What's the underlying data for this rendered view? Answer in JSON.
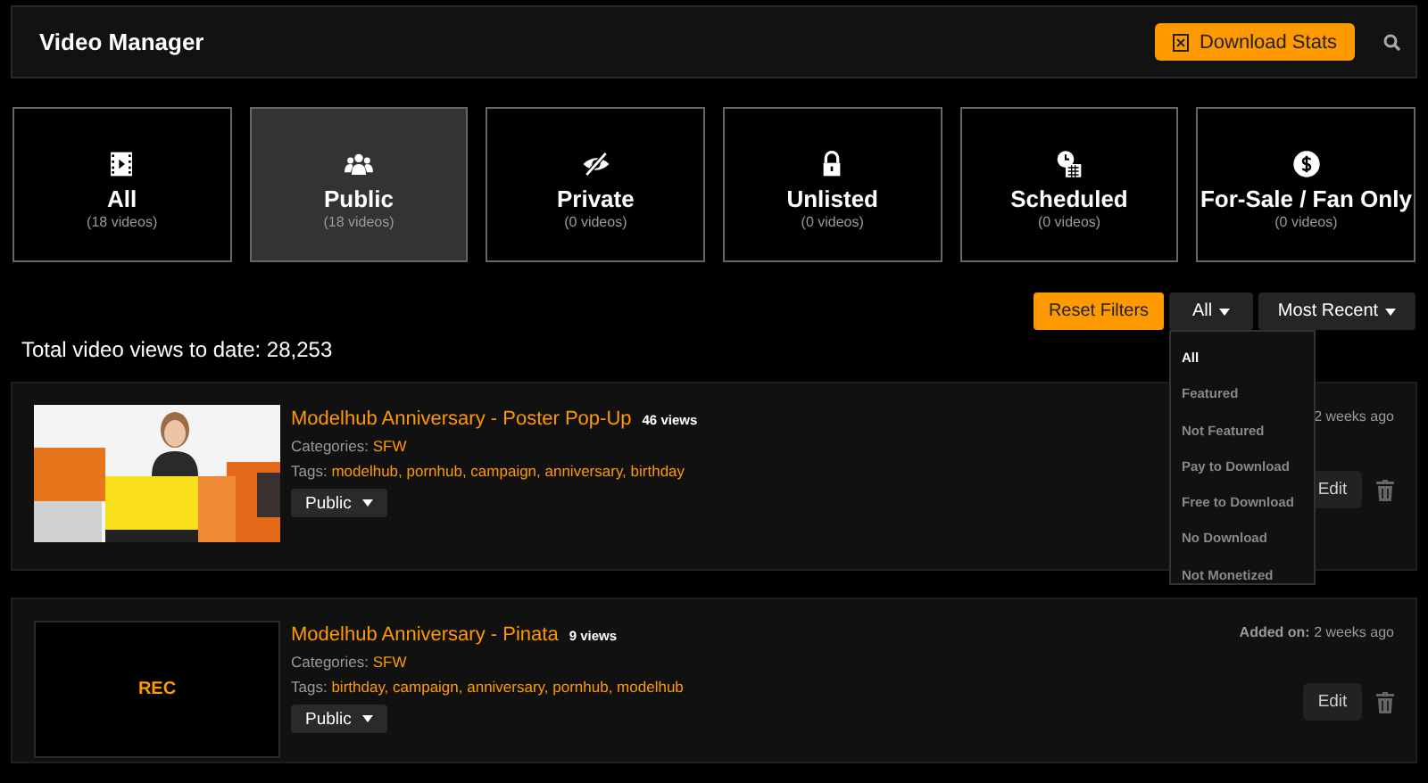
{
  "header": {
    "title": "Video Manager",
    "download_button": "Download Stats"
  },
  "categories": [
    {
      "kind": "film",
      "label": "All",
      "count": "(18 videos)",
      "selected": false
    },
    {
      "kind": "people",
      "label": "Public",
      "count": "(18 videos)",
      "selected": true
    },
    {
      "kind": "eye-off",
      "label": "Private",
      "count": "(0 videos)",
      "selected": false
    },
    {
      "kind": "lock",
      "label": "Unlisted",
      "count": "(0 videos)",
      "selected": false
    },
    {
      "kind": "clock",
      "label": "Scheduled",
      "count": "(0 videos)",
      "selected": false
    },
    {
      "kind": "dollar",
      "label": "For-Sale / Fan Only",
      "count": "(0 videos)",
      "selected": false
    }
  ],
  "filters": {
    "reset": "Reset Filters",
    "type_filter": "All",
    "sort": "Most Recent"
  },
  "total_views": "Total video views to date: 28,253",
  "videos": [
    {
      "title": "Modelhub Anniversary - Poster Pop-Up",
      "views": "46 views",
      "categories_label": "Categories:",
      "category": "SFW",
      "tags_label": "Tags:",
      "tags": "modelhub, pornhub, campaign, anniversary, birthday",
      "visibility": "Public",
      "added_value": "2 weeks ago",
      "edit": "Edit"
    },
    {
      "thumbnail": {
        "kind": "placeholder",
        "text": "REC"
      },
      "title": "Modelhub Anniversary - Pinata",
      "views": "9 views",
      "categories_label": "Categories:",
      "category": "SFW",
      "tags_label": "Tags:",
      "tags": "birthday, campaign, anniversary, pornhub, modelhub",
      "visibility": "Public",
      "added_label": "Added on:",
      "added_value": " 2 weeks ago",
      "edit": "Edit"
    }
  ],
  "type_menu": [
    {
      "label": "All",
      "selected": true
    },
    {
      "label": "Featured",
      "selected": false
    },
    {
      "label": "Not Featured",
      "selected": false
    },
    {
      "label": "Pay to Download",
      "selected": false
    },
    {
      "label": "Free to Download",
      "selected": false
    },
    {
      "label": "No Download",
      "selected": false
    },
    {
      "label": "Not Monetized",
      "selected": false
    }
  ]
}
